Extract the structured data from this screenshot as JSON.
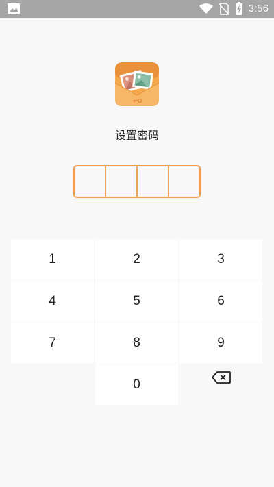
{
  "status_bar": {
    "time": "3:56",
    "icons": [
      "image-icon",
      "wifi-icon",
      "no-sim-icon",
      "battery-charging-icon"
    ]
  },
  "app": {
    "icon": "photo-envelope-lock-icon"
  },
  "title": "设置密码",
  "pin": {
    "length": 4,
    "entered": [
      "",
      "",
      "",
      ""
    ]
  },
  "keypad": {
    "keys": [
      "1",
      "2",
      "3",
      "4",
      "5",
      "6",
      "7",
      "8",
      "9",
      "",
      "0",
      ""
    ],
    "backspace_icon": "backspace-icon"
  },
  "colors": {
    "accent": "#f0a050",
    "status_bar": "#a5a5a5",
    "background": "#f8f8f8"
  }
}
